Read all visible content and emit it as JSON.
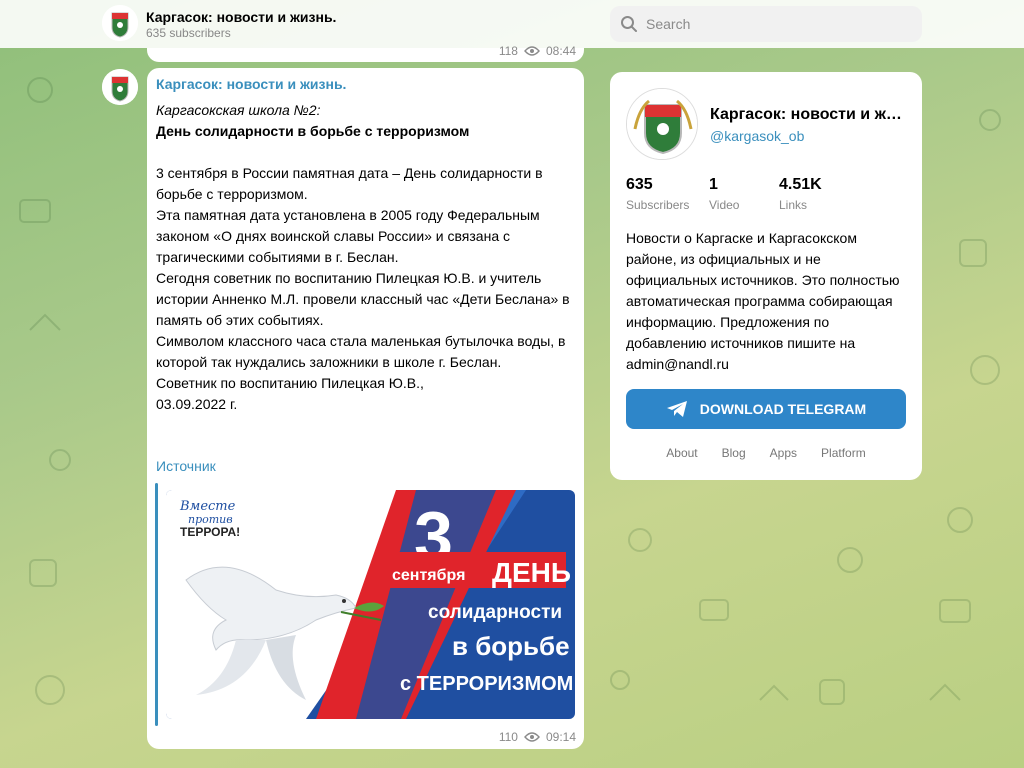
{
  "header": {
    "channel_name": "Каргасок: новости и жизнь.",
    "subscribers": "635 subscribers",
    "search_placeholder": "Search"
  },
  "previous_message": {
    "views": "118",
    "time": "08:44"
  },
  "message": {
    "channel_name": "Каргасок: новости и жизнь.",
    "lines": [
      "Каргасокская школа №2:",
      "День солидарности в борьбе с терроризмом",
      "",
      "3 сентября в России памятная дата – День солидарности в",
      "борьбе с терроризмом.",
      "Эта памятная дата установлена в 2005 году Федеральным",
      "законом «О днях воинской славы России» и связана с",
      "трагическими событиями в г. Беслан.",
      "Сегодня советник по воспитанию Пилецкая Ю.В. и учитель",
      "истории Анненко М.Л. провели классный час «Дети Беслана» в",
      "память об этих событиях.",
      "Символом классного часа стала маленькая бутылочка воды, в",
      "которой так нуждались заложники в школе г. Беслан.",
      "Советник по воспитанию Пилецкая Ю.В.,",
      "03.09.2022 г."
    ],
    "link_text": "Источник",
    "poster": {
      "tag_line1": "Вместе",
      "tag_line2": "против",
      "tag_line3": "ТЕРРОРА!",
      "day_number": "3",
      "month": "сентября",
      "title_word1": "ДЕНЬ",
      "title_word2": "солидарности",
      "title_word3": "в борьбе",
      "title_word4": "с ТЕРРОРИЗМОМ"
    },
    "views": "110",
    "time": "09:14"
  },
  "card": {
    "name": "Каргасок: новости и жизнь.",
    "handle": "@kargasok_ob",
    "stats": [
      {
        "value": "635",
        "label": "Subscribers"
      },
      {
        "value": "1",
        "label": "Video"
      },
      {
        "value": "4.51K",
        "label": "Links"
      }
    ],
    "description_lines": [
      "Новости о Каргаске и Каргасокском",
      "районе, из официальных и не",
      "официальных источников. Это полностью",
      "автоматическая программа собирающая",
      "информацию. Предложения по",
      "добавлению источников пишите на",
      "admin@nandl.ru"
    ],
    "download_label": "DOWNLOAD TELEGRAM",
    "links": [
      "About",
      "Blog",
      "Apps",
      "Platform"
    ]
  },
  "colors": {
    "accent": "#2e86c9",
    "link": "#3a8fbd",
    "poster_blue": "#1f4fa1",
    "poster_red": "#e0242b"
  },
  "icons": {
    "search": "search-icon",
    "views": "eye-icon",
    "download": "telegram-plane-icon",
    "avatar": "coat-of-arms-icon"
  }
}
